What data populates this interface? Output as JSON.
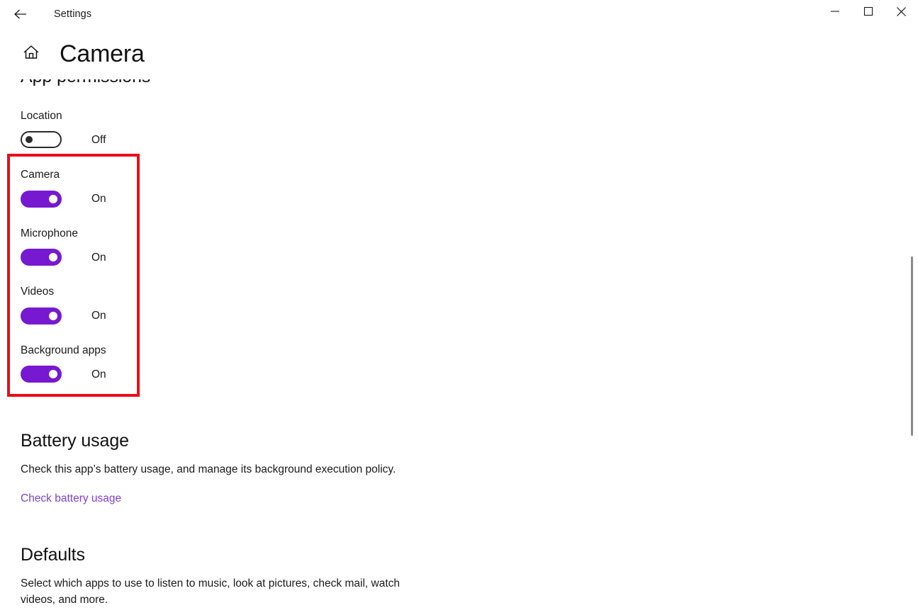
{
  "titlebar": {
    "back_label": "back-arrow",
    "app_title": "Settings",
    "minimize_label": "Minimize",
    "maximize_label": "Maximize",
    "close_label": "Close"
  },
  "header": {
    "home_label": "Home",
    "page_title": "Camera"
  },
  "colors": {
    "toggle_on": "#7719d0",
    "link": "#7b3fd4",
    "highlight_border": "#ef0a19",
    "text": "#1a1a1a"
  },
  "sections": {
    "app_permissions": {
      "heading": "App permissions",
      "permissions": [
        {
          "label": "Location",
          "state": "Off",
          "on": false
        },
        {
          "label": "Camera",
          "state": "On",
          "on": true
        },
        {
          "label": "Microphone",
          "state": "On",
          "on": true
        },
        {
          "label": "Videos",
          "state": "On",
          "on": true
        },
        {
          "label": "Background apps",
          "state": "On",
          "on": true
        }
      ]
    },
    "battery_usage": {
      "heading": "Battery usage",
      "description": "Check this app’s battery usage, and manage its background execution policy.",
      "link_label": "Check battery usage"
    },
    "defaults": {
      "heading": "Defaults",
      "description": "Select which apps to use to listen to music, look at pictures, check mail, watch videos, and more."
    }
  }
}
